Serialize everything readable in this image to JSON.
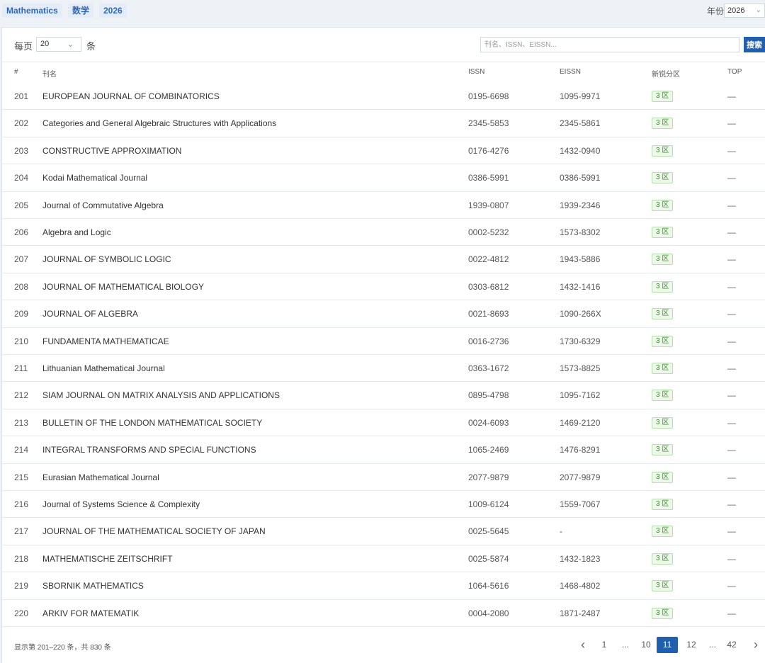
{
  "tags": [
    "Mathematics",
    "数学",
    "2026"
  ],
  "year": {
    "label": "年份",
    "selected": "2026"
  },
  "toolbar": {
    "per_page_label": "每页",
    "per_page_value": "20",
    "per_page_unit": "条",
    "search_placeholder": "刊名、ISSN、EISSN...",
    "search_button": "搜索"
  },
  "columns": {
    "num": "#",
    "title": "刊名",
    "issn": "ISSN",
    "eissn": "EISSN",
    "zone": "新锐分区",
    "top": "TOP"
  },
  "rows": [
    {
      "num": "201",
      "title": "EUROPEAN JOURNAL OF COMBINATORICS",
      "issn": "0195-6698",
      "eissn": "1095-9971",
      "zone": "3 区",
      "top": "—"
    },
    {
      "num": "202",
      "title": "Categories and General Algebraic Structures with Applications",
      "issn": "2345-5853",
      "eissn": "2345-5861",
      "zone": "3 区",
      "top": "—"
    },
    {
      "num": "203",
      "title": "CONSTRUCTIVE APPROXIMATION",
      "issn": "0176-4276",
      "eissn": "1432-0940",
      "zone": "3 区",
      "top": "—"
    },
    {
      "num": "204",
      "title": "Kodai Mathematical Journal",
      "issn": "0386-5991",
      "eissn": "0386-5991",
      "zone": "3 区",
      "top": "—"
    },
    {
      "num": "205",
      "title": "Journal of Commutative Algebra",
      "issn": "1939-0807",
      "eissn": "1939-2346",
      "zone": "3 区",
      "top": "—"
    },
    {
      "num": "206",
      "title": "Algebra and Logic",
      "issn": "0002-5232",
      "eissn": "1573-8302",
      "zone": "3 区",
      "top": "—"
    },
    {
      "num": "207",
      "title": "JOURNAL OF SYMBOLIC LOGIC",
      "issn": "0022-4812",
      "eissn": "1943-5886",
      "zone": "3 区",
      "top": "—"
    },
    {
      "num": "208",
      "title": "JOURNAL OF MATHEMATICAL BIOLOGY",
      "issn": "0303-6812",
      "eissn": "1432-1416",
      "zone": "3 区",
      "top": "—"
    },
    {
      "num": "209",
      "title": "JOURNAL OF ALGEBRA",
      "issn": "0021-8693",
      "eissn": "1090-266X",
      "zone": "3 区",
      "top": "—"
    },
    {
      "num": "210",
      "title": "FUNDAMENTA MATHEMATICAE",
      "issn": "0016-2736",
      "eissn": "1730-6329",
      "zone": "3 区",
      "top": "—"
    },
    {
      "num": "211",
      "title": "Lithuanian Mathematical Journal",
      "issn": "0363-1672",
      "eissn": "1573-8825",
      "zone": "3 区",
      "top": "—"
    },
    {
      "num": "212",
      "title": "SIAM JOURNAL ON MATRIX ANALYSIS AND APPLICATIONS",
      "issn": "0895-4798",
      "eissn": "1095-7162",
      "zone": "3 区",
      "top": "—"
    },
    {
      "num": "213",
      "title": "BULLETIN OF THE LONDON MATHEMATICAL SOCIETY",
      "issn": "0024-6093",
      "eissn": "1469-2120",
      "zone": "3 区",
      "top": "—"
    },
    {
      "num": "214",
      "title": "INTEGRAL TRANSFORMS AND SPECIAL FUNCTIONS",
      "issn": "1065-2469",
      "eissn": "1476-8291",
      "zone": "3 区",
      "top": "—"
    },
    {
      "num": "215",
      "title": "Eurasian Mathematical Journal",
      "issn": "2077-9879",
      "eissn": "2077-9879",
      "zone": "3 区",
      "top": "—"
    },
    {
      "num": "216",
      "title": "Journal of Systems Science & Complexity",
      "issn": "1009-6124",
      "eissn": "1559-7067",
      "zone": "3 区",
      "top": "—"
    },
    {
      "num": "217",
      "title": "JOURNAL OF THE MATHEMATICAL SOCIETY OF JAPAN",
      "issn": "0025-5645",
      "eissn": "-",
      "zone": "3 区",
      "top": "—"
    },
    {
      "num": "218",
      "title": "MATHEMATISCHE ZEITSCHRIFT",
      "issn": "0025-5874",
      "eissn": "1432-1823",
      "zone": "3 区",
      "top": "—"
    },
    {
      "num": "219",
      "title": "SBORNIK MATHEMATICS",
      "issn": "1064-5616",
      "eissn": "1468-4802",
      "zone": "3 区",
      "top": "—"
    },
    {
      "num": "220",
      "title": "ARKIV FOR MATEMATIK",
      "issn": "0004-2080",
      "eissn": "1871-2487",
      "zone": "3 区",
      "top": "—"
    }
  ],
  "footer": {
    "summary": "显示第 201–220 条，共 830 条",
    "pager": [
      {
        "label": "‹",
        "kind": "prev"
      },
      {
        "label": "1",
        "kind": "page"
      },
      {
        "label": "...",
        "kind": "ellipsis"
      },
      {
        "label": "10",
        "kind": "page"
      },
      {
        "label": "11",
        "kind": "page",
        "active": true
      },
      {
        "label": "12",
        "kind": "page"
      },
      {
        "label": "...",
        "kind": "ellipsis"
      },
      {
        "label": "42",
        "kind": "page"
      },
      {
        "label": "›",
        "kind": "next"
      }
    ]
  }
}
